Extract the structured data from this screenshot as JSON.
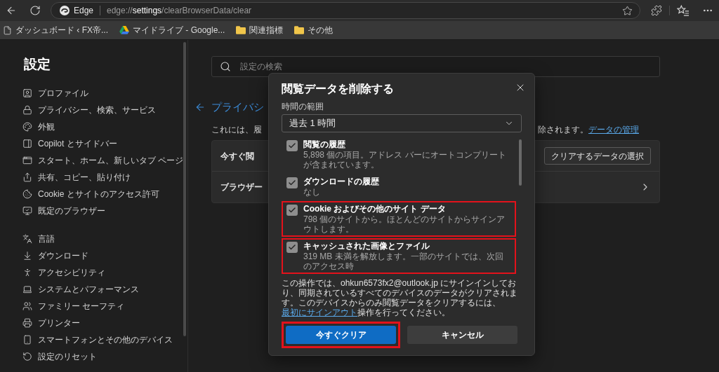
{
  "toolbar": {
    "site_label": "Edge",
    "url": "edge://**settings**/clearBrowserData/clear"
  },
  "bookmarks": [
    {
      "kind": "page",
      "label": "ダッシュボード ‹ FX帝..."
    },
    {
      "kind": "drive",
      "label": "マイドライブ - Google..."
    },
    {
      "kind": "folder",
      "label": "関連指標"
    },
    {
      "kind": "folder",
      "label": "その他"
    }
  ],
  "sidebar": {
    "title": "設定",
    "groups": [
      {
        "items": [
          {
            "label": "プロファイル"
          },
          {
            "label": "プライバシー、検索、サービス"
          },
          {
            "label": "外観"
          },
          {
            "label": "Copilot とサイドバー"
          },
          {
            "label": "スタート、ホーム、新しいタブ ページ"
          },
          {
            "label": "共有、コピー、貼り付け"
          },
          {
            "label": "Cookie とサイトのアクセス許可"
          },
          {
            "label": "既定のブラウザー"
          }
        ]
      },
      {
        "items": [
          {
            "label": "言語"
          },
          {
            "label": "ダウンロード"
          },
          {
            "label": "アクセシビリティ"
          },
          {
            "label": "システムとパフォーマンス"
          },
          {
            "label": "ファミリー セーフティ"
          },
          {
            "label": "プリンター"
          },
          {
            "label": "スマートフォンとその他のデバイス"
          },
          {
            "label": "設定のリセット"
          }
        ]
      }
    ]
  },
  "page": {
    "search_placeholder": "設定の検索",
    "title": "プライバシ",
    "description_left": "これには、履",
    "description_right": "除されます。",
    "description_link": "データの管理",
    "rows": [
      {
        "kind": "action",
        "label": "今すぐ閲",
        "button": "クリアするデータの選択"
      },
      {
        "kind": "nav",
        "label": "ブラウザー"
      }
    ]
  },
  "dialog": {
    "title": "閲覧データを削除する",
    "time_range": {
      "label": "時間の範囲",
      "value": "過去 1 時間"
    },
    "items": [
      {
        "title": "閲覧の履歴",
        "description": "5,898 個の項目。アドレス バーにオートコンプリートが含まれています。",
        "checked": true,
        "highlighted": false
      },
      {
        "title": "ダウンロードの履歴",
        "description": "なし",
        "checked": true,
        "highlighted": false
      },
      {
        "title": "Cookie およびその他のサイト データ",
        "description": "798 個のサイトから。ほとんどのサイトからサインアウトします。",
        "checked": true,
        "highlighted": true
      },
      {
        "title": "キャッシュされた画像とファイル",
        "description": "319 MB 未満を解放します。一部のサイトでは、次回のアクセス時",
        "checked": true,
        "highlighted": true
      }
    ],
    "notice": {
      "text_before": "この操作では、ohkun6573fx2@outlook.jp にサインインしており、同期されているすべてのデバイスのデータがクリアされます。このデバイスからのみ閲覧データをクリアするには、",
      "link": "最初にサインアウト",
      "text_after": "操作を行ってください。"
    },
    "buttons": [
      {
        "label": "今すぐクリア",
        "kind": "primary",
        "highlighted": true
      },
      {
        "label": "キャンセル",
        "kind": "secondary",
        "highlighted": false
      }
    ]
  }
}
